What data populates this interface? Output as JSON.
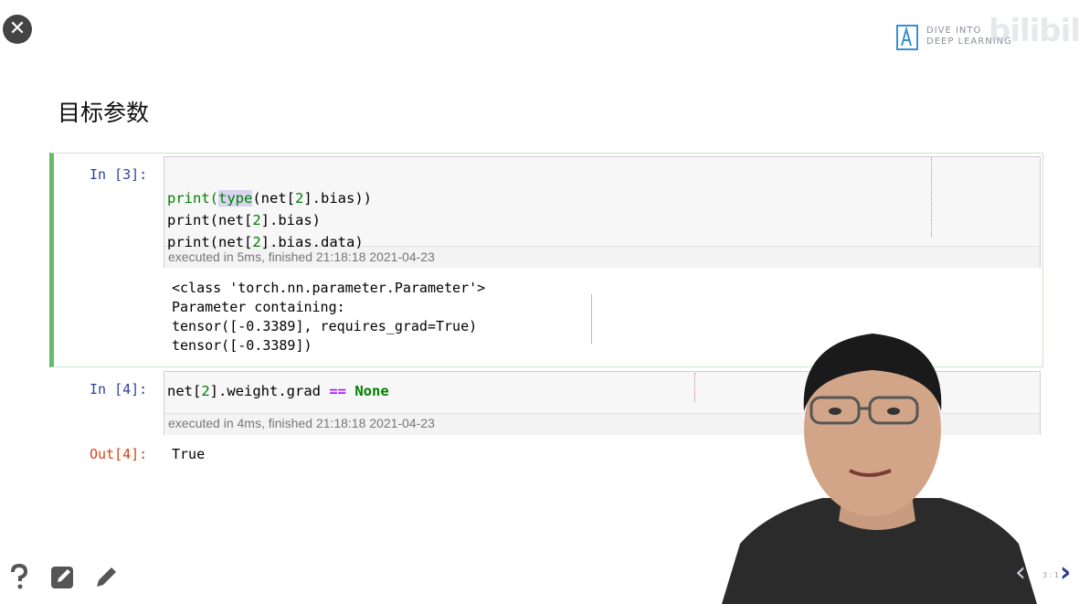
{
  "slide": {
    "heading": "目标参数",
    "slide_number": "3 : 1"
  },
  "logo": {
    "line1": "DIVE INTO",
    "line2": "DEEP LEARNING",
    "watermark": "bilibili"
  },
  "cells": [
    {
      "prompt": "In [3]:",
      "code_lines": [
        [
          "print(",
          "type",
          "(net[",
          "2",
          "].bias))"
        ],
        [
          "print(net[",
          "2",
          "].bias)"
        ],
        [
          "print(net[",
          "2",
          "].bias.data)"
        ]
      ],
      "exec_info": "executed in 5ms, finished 21:18:18 2021-04-23",
      "output_lines": [
        "<class 'torch.nn.parameter.Parameter'>",
        "Parameter containing:",
        "tensor([-0.3389], requires_grad=True)",
        "tensor([-0.3389])"
      ]
    },
    {
      "prompt": "In [4]:",
      "code": {
        "a": "net[",
        "n": "2",
        "b": "].weight.grad ",
        "op": "==",
        "c": "None"
      },
      "exec_info": "executed in 4ms, finished 21:18:18 2021-04-23",
      "out_prompt": "Out[4]:",
      "output": "True"
    }
  ],
  "icons": [
    "close-icon",
    "help-icon",
    "edit-square-icon",
    "pencil-icon",
    "chevron-left-icon",
    "chevron-right-icon"
  ],
  "colors": {
    "selected_border": "#66bb6a",
    "in_prompt": "#303f9f",
    "out_prompt": "#d84315",
    "builtin": "#008000",
    "operator": "#aa22ff"
  }
}
